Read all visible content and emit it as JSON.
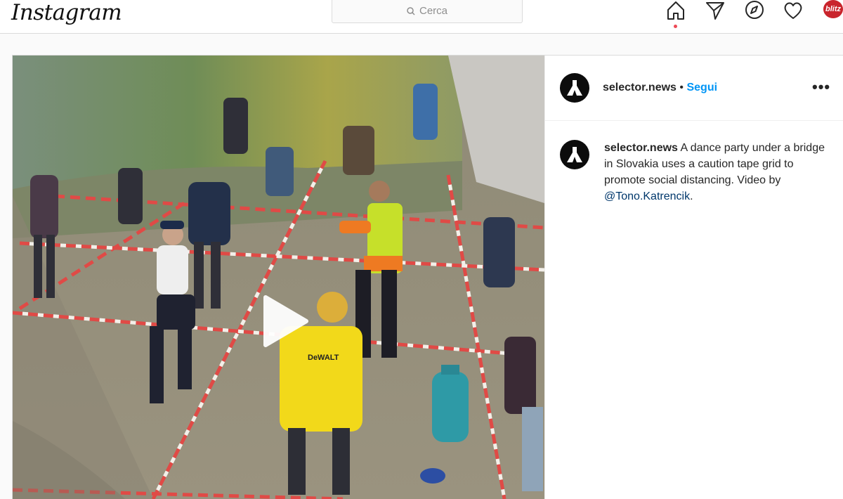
{
  "header": {
    "logo": "Instagram",
    "search_placeholder": "Cerca",
    "icons": [
      "home-icon",
      "direct-icon",
      "explore-icon",
      "activity-icon",
      "profile-avatar"
    ],
    "avatar_text": "blitz"
  },
  "post": {
    "username": "selector.news",
    "separator": "•",
    "follow_label": "Segui",
    "more_label": "•••",
    "caption_user": "selector.news",
    "caption_text": "A dance party under a bridge in Slovakia uses a caution tape grid to promote social distancing. Video by",
    "caption_mention": "@Tono.Katrencik",
    "caption_end": ".",
    "media_type": "video",
    "shirt_text": "DeWALT"
  },
  "colors": {
    "accent": "#0095f6",
    "notification": "#ed4956",
    "tape_red": "#d9302c"
  }
}
